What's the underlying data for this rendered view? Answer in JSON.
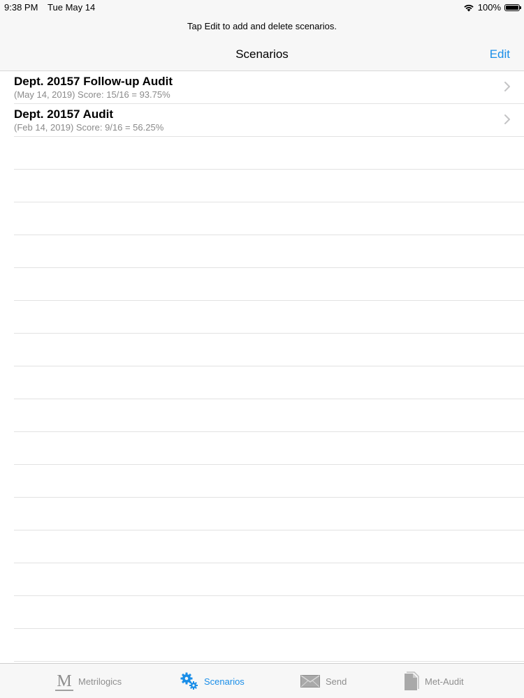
{
  "status_bar": {
    "time": "9:38 PM",
    "date": "Tue May 14",
    "battery": "100%"
  },
  "nav": {
    "prompt": "Tap Edit to add and delete scenarios.",
    "title": "Scenarios",
    "edit_label": "Edit"
  },
  "scenarios": [
    {
      "title": "Dept. 20157 Follow-up Audit",
      "subtitle": "(May 14, 2019) Score: 15/16 = 93.75%"
    },
    {
      "title": "Dept. 20157 Audit",
      "subtitle": "(Feb 14, 2019) Score: 9/16 = 56.25%"
    }
  ],
  "tabs": [
    {
      "label": "Metrilogics",
      "icon": "metrilogics-logo-icon",
      "active": false
    },
    {
      "label": "Scenarios",
      "icon": "gears-icon",
      "active": true
    },
    {
      "label": "Send",
      "icon": "envelope-icon",
      "active": false
    },
    {
      "label": "Met-Audit",
      "icon": "document-icon",
      "active": false
    }
  ],
  "colors": {
    "accent": "#1a8ee8",
    "inactive_tab": "#8e8e8e",
    "subtitle": "#8a8a8a",
    "bar_background": "#f7f7f7"
  }
}
